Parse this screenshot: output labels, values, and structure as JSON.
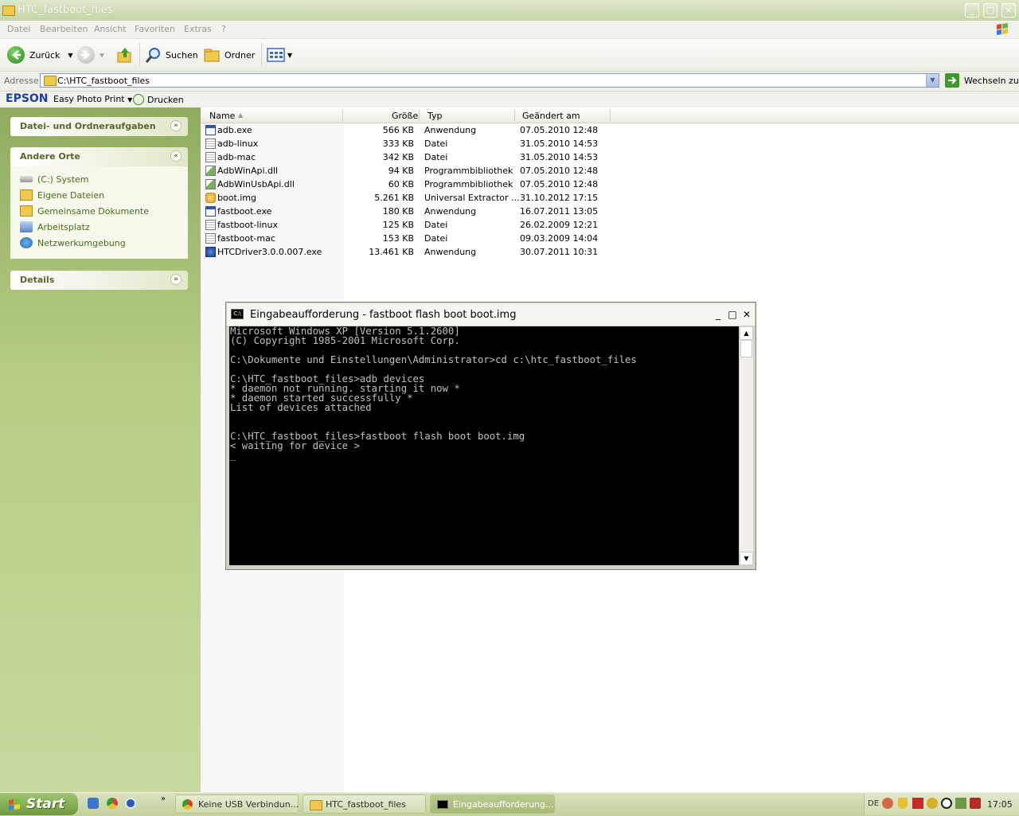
{
  "window": {
    "title": "HTC_fastboot_files"
  },
  "menu": [
    "Datei",
    "Bearbeiten",
    "Ansicht",
    "Favoriten",
    "Extras",
    "?"
  ],
  "toolbar": {
    "back_label": "Zurück",
    "search_label": "Suchen",
    "folders_label": "Ordner"
  },
  "address": {
    "label": "Adresse",
    "value": "C:\\HTC_fastboot_files",
    "go_label": "Wechseln zu"
  },
  "epson": {
    "brand": "EPSON",
    "photo_print": "Easy Photo Print",
    "print": "Drucken"
  },
  "taskpane": {
    "tasks_header": "Datei- und Ordneraufgaben",
    "places_header": "Andere Orte",
    "places": [
      "(C:) System",
      "Eigene Dateien",
      "Gemeinsame Dokumente",
      "Arbeitsplatz",
      "Netzwerkumgebung"
    ],
    "details_header": "Details"
  },
  "columns": {
    "name": "Name",
    "size": "Größe",
    "type": "Typ",
    "modified": "Geändert am"
  },
  "files": [
    {
      "name": "adb.exe",
      "size": "566 KB",
      "type": "Anwendung",
      "modified": "07.05.2010 12:48",
      "icon": "exe-icon"
    },
    {
      "name": "adb-linux",
      "size": "333 KB",
      "type": "Datei",
      "modified": "31.05.2010 14:53",
      "icon": "file-icon"
    },
    {
      "name": "adb-mac",
      "size": "342 KB",
      "type": "Datei",
      "modified": "31.05.2010 14:53",
      "icon": "file-icon"
    },
    {
      "name": "AdbWinApi.dll",
      "size": "94 KB",
      "type": "Programmbibliothek",
      "modified": "07.05.2010 12:48",
      "icon": "dll-icon"
    },
    {
      "name": "AdbWinUsbApi.dll",
      "size": "60 KB",
      "type": "Programmbibliothek",
      "modified": "07.05.2010 12:48",
      "icon": "dll-icon"
    },
    {
      "name": "boot.img",
      "size": "5.261 KB",
      "type": "Universal Extractor ...",
      "modified": "31.10.2012 17:15",
      "icon": "img-icon"
    },
    {
      "name": "fastboot.exe",
      "size": "180 KB",
      "type": "Anwendung",
      "modified": "16.07.2011 13:05",
      "icon": "exe-icon"
    },
    {
      "name": "fastboot-linux",
      "size": "125 KB",
      "type": "Datei",
      "modified": "26.02.2009 12:21",
      "icon": "file-icon"
    },
    {
      "name": "fastboot-mac",
      "size": "153 KB",
      "type": "Datei",
      "modified": "09.03.2009 14:04",
      "icon": "file-icon"
    },
    {
      "name": "HTCDriver3.0.0.007.exe",
      "size": "13.461 KB",
      "type": "Anwendung",
      "modified": "30.07.2011 10:31",
      "icon": "setup-icon"
    }
  ],
  "console": {
    "title": "Eingabeaufforderung - fastboot flash boot boot.img",
    "lines": [
      "Microsoft Windows XP [Version 5.1.2600]",
      "(C) Copyright 1985-2001 Microsoft Corp.",
      "",
      "C:\\Dokumente und Einstellungen\\Administrator>cd c:\\htc_fastboot_files",
      "",
      "C:\\HTC_fastboot_files>adb devices",
      "* daemon not running. starting it now *",
      "* daemon started successfully *",
      "List of devices attached",
      "",
      "",
      "C:\\HTC_fastboot_files>fastboot flash boot boot.img",
      "< waiting for device >",
      "_"
    ]
  },
  "taskbar": {
    "start": "Start",
    "buttons": [
      "Keine USB Verbindun...",
      "HTC_fastboot_files",
      "Eingabeaufforderung..."
    ],
    "lang": "DE",
    "clock": "17:05"
  }
}
